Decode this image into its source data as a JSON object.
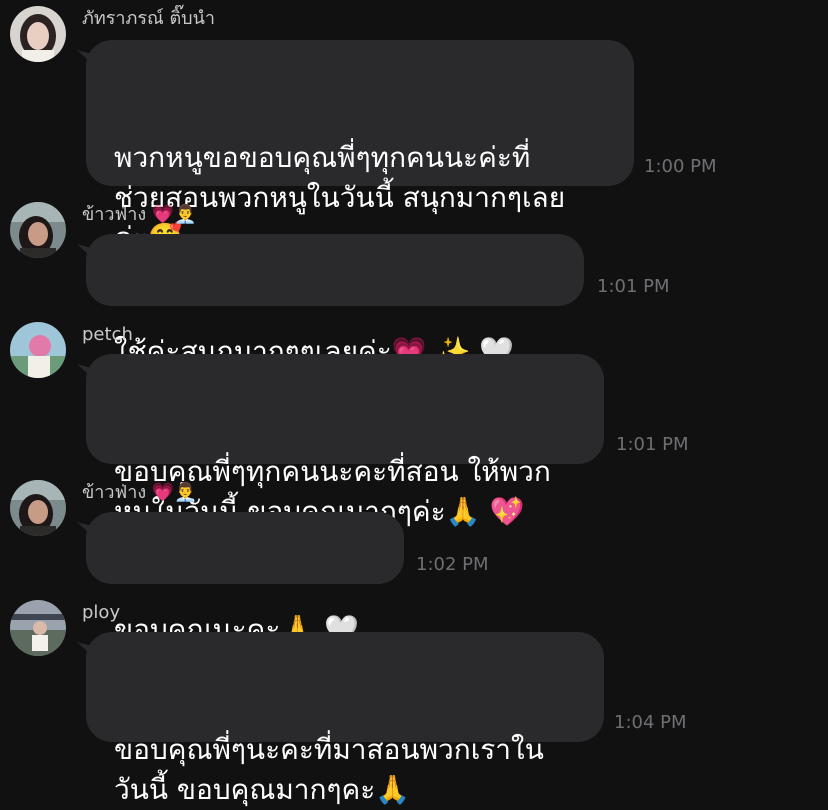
{
  "messages": [
    {
      "sender": "ภัทราภรณ์ ติ๊บนำ",
      "text": "พวกหนูขอขอบคุณพี่ๆทุกคนนะค่ะที่\nช่วยสอนพวกหนูในวันนี้ สนุกมากๆเลย\nค่ะ🥰",
      "time": "1:00 PM"
    },
    {
      "sender": "ข้าวฟ่าง 💗👨‍💼",
      "text": "ใช้ค่ะสนุกมากๆๆเลยค่ะ💗 ✨ 🤍",
      "time": "1:01 PM"
    },
    {
      "sender": "petch",
      "text": "ขอบคุณพี่ๆทุกคนนะคะที่สอน ให้พวก\nหนูในวันนี้ ขอบคุณมากๆค่ะ🙏 💖",
      "time": "1:01 PM"
    },
    {
      "sender": "ข้าวฟ่าง 💗👨‍💼",
      "text": "ขอบคุณนะคะ🙏 🤍",
      "time": "1:02 PM"
    },
    {
      "sender": "ploy",
      "text": "ขอบคุณพี่ๆนะคะที่มาสอนพวกเราใน\nวันนี้ ขอบคุณมากๆคะ🙏",
      "time": "1:04 PM"
    }
  ]
}
